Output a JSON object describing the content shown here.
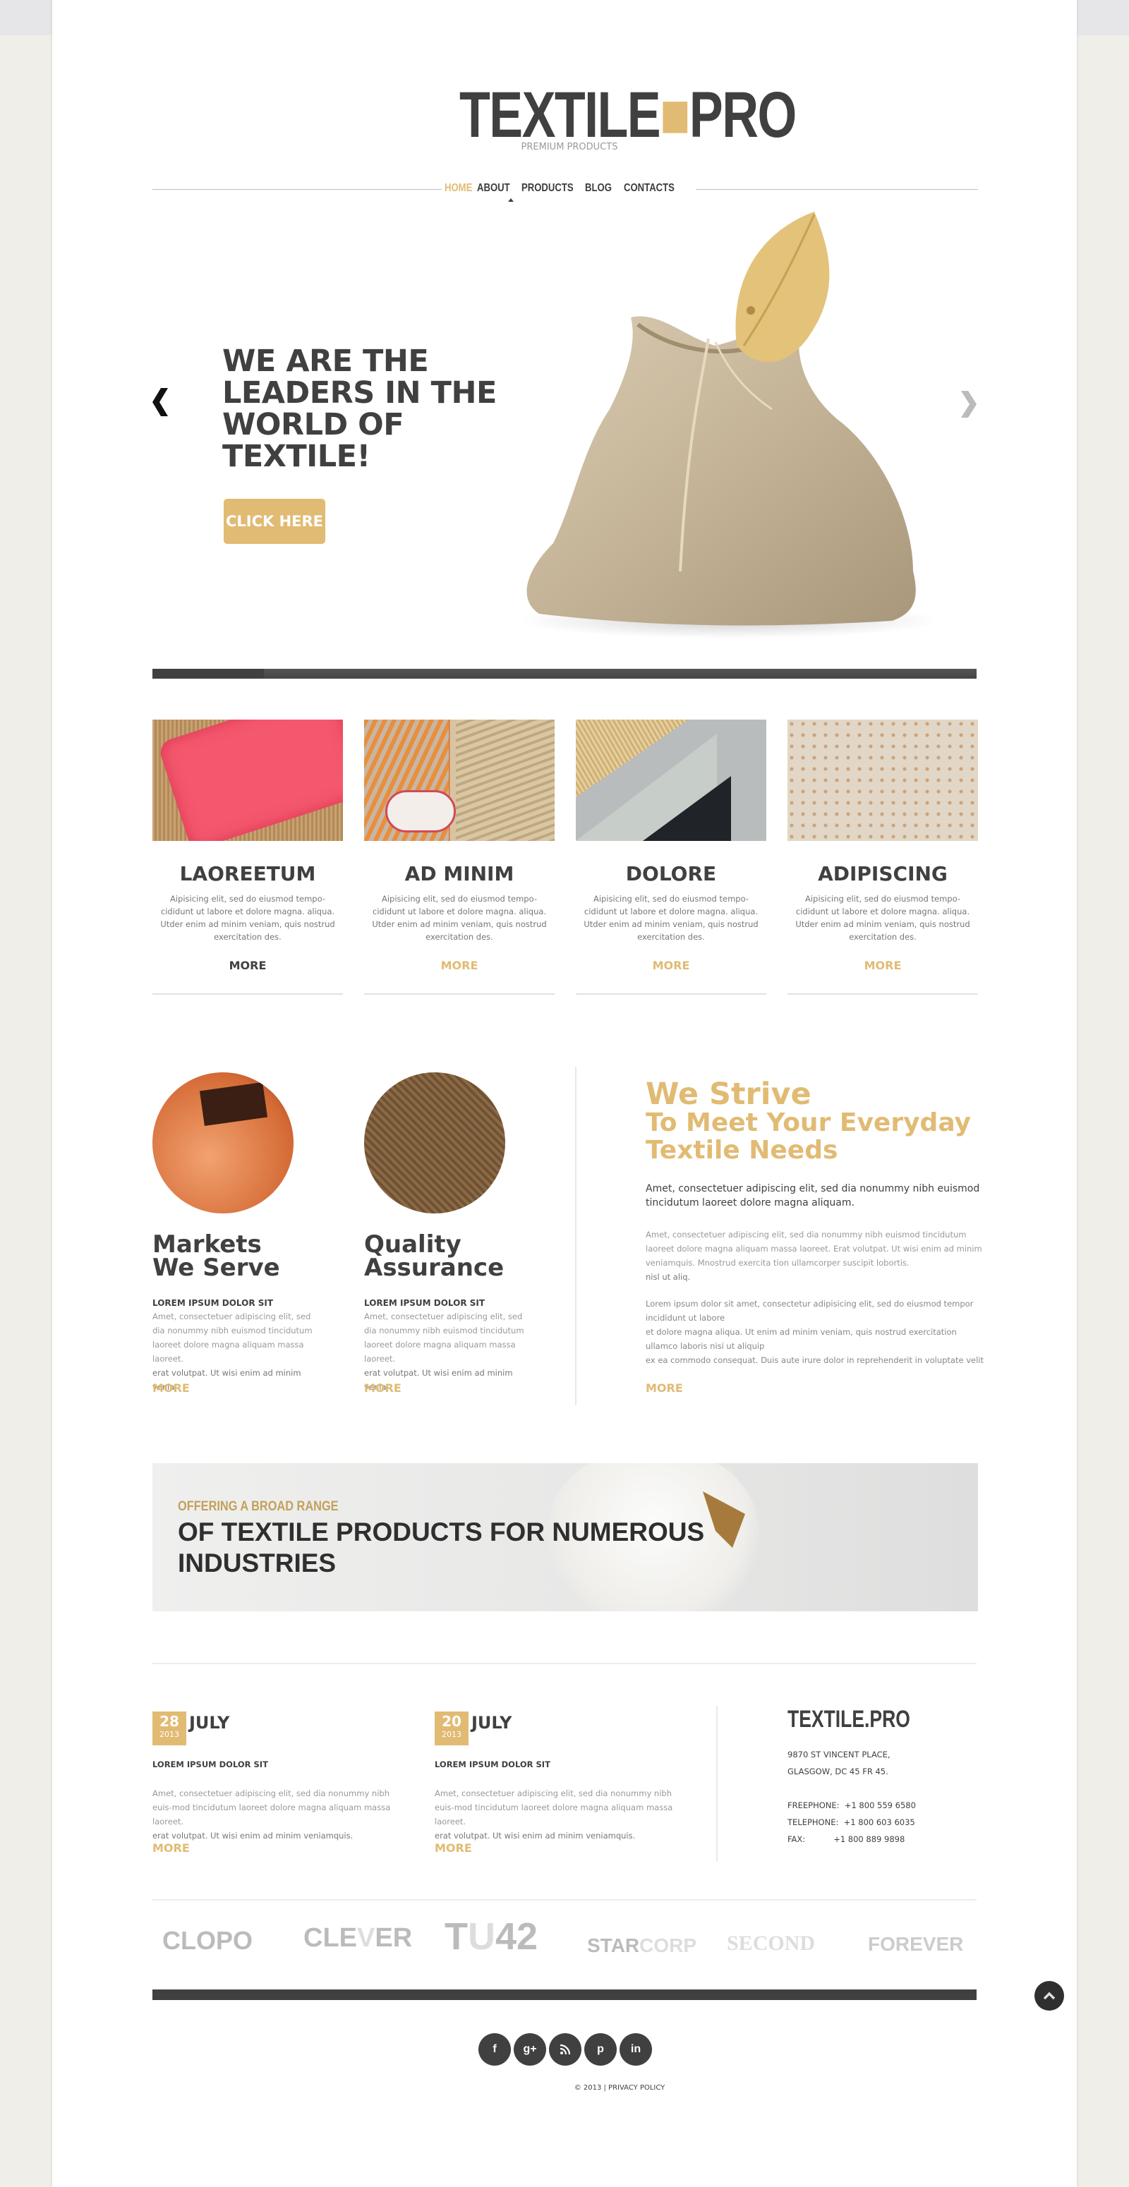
{
  "brand": {
    "name_main": "TEXTILE",
    "name_dot": ".",
    "name_tail": "PRO",
    "tagline": "PREMIUM PRODUCTS"
  },
  "nav": {
    "items": [
      {
        "label": "HOME",
        "active": true
      },
      {
        "label": "ABOUT",
        "active": false
      },
      {
        "label": "PRODUCTS",
        "active": false
      },
      {
        "label": "BLOG",
        "active": false
      },
      {
        "label": "CONTACTS",
        "active": false
      }
    ]
  },
  "hero": {
    "title": "WE ARE THE LEADERS IN THE WORLD OF TEXTILE!",
    "button_label": "CLICK HERE",
    "prev_icon": "chevron-left-icon",
    "next_icon": "chevron-right-icon"
  },
  "products": [
    {
      "title": "LAOREETUM",
      "text": "Aipisicing elit, sed do eiusmod tempo-cididunt ut labore et dolore magna. aliqua. Utder enim ad minim veniam, quis nostrud exercitation des.",
      "more": "MORE"
    },
    {
      "title": "AD MINIM",
      "text": "Aipisicing elit, sed do eiusmod tempo-cididunt ut labore et dolore magna. aliqua. Utder enim ad minim veniam, quis nostrud exercitation des.",
      "more": "MORE"
    },
    {
      "title": "DOLORE",
      "text": "Aipisicing elit, sed do eiusmod tempo-cididunt ut labore et dolore magna. aliqua. Utder enim ad minim veniam, quis nostrud exercitation des.",
      "more": "MORE"
    },
    {
      "title": "ADIPISCING",
      "text": "Aipisicing elit, sed do eiusmod tempo-cididunt ut labore et dolore magna. aliqua. Utder enim ad minim veniam, quis nostrud exercitation des.",
      "more": "MORE"
    }
  ],
  "features": [
    {
      "title_l1": "Markets",
      "title_l2": "We Serve",
      "subtitle": "LOREM IPSUM DOLOR SIT",
      "text": "Amet, consectetuer adipiscing elit, sed dia nonummy nibh euismod tincidutum laoreet dolore magna aliquam massa laoreet.",
      "text2": "erat volutpat. Ut wisi enim ad minim venia-",
      "more": "MORE"
    },
    {
      "title_l1": "Quality",
      "title_l2": "Assurance",
      "subtitle": "LOREM IPSUM DOLOR SIT",
      "text": "Amet, consectetuer adipiscing elit, sed dia nonummy nibh euismod tincidutum laoreet dolore magna aliquam massa laoreet.",
      "text2": "erat volutpat. Ut wisi enim ad minim venia-",
      "more": "MORE"
    }
  ],
  "strive": {
    "title_l1": "We Strive",
    "title_l2": "To Meet Your Everyday",
    "title_l3": "Textile Needs",
    "lead": "Amet, consectetuer adipiscing elit, sed dia nonummy nibh euismod tincidutum laoreet dolore magna aliquam.",
    "para1": "Amet, consectetuer adipiscing elit, sed dia nonummy nibh euismod tincidutum laoreet dolore magna aliquam massa laoreet. Erat volutpat. Ut wisi enim ad minim veniamquis. Mnostrud exercita tion ullamcorper suscipit lobortis.",
    "para1_tail": "nisl ut aliq.",
    "para2_l1": "Lorem ipsum dolor sit amet, consectetur adipisicing elit, sed do eiusmod tempor incididunt ut labore",
    "para2_l2": "et dolore magna aliqua. Ut enim ad minim veniam, quis nostrud exercitation ullamco laboris nisi ut aliquip",
    "para2_l3": "ex ea commodo consequat. Duis aute irure dolor in reprehenderit in voluptate velit",
    "more": "MORE"
  },
  "banner": {
    "subtitle": "OFFERING A BROAD RANGE",
    "title": "OF TEXTILE PRODUCTS FOR NUMEROUS INDUSTRIES"
  },
  "blog": [
    {
      "day": "28",
      "year": "2013",
      "month": "JULY",
      "title": "LOREM IPSUM DOLOR SIT",
      "text": "Amet, consectetuer adipiscing elit, sed dia nonummy nibh euis-mod tincidutum laoreet dolore magna aliquam massa laoreet.",
      "text2": "erat volutpat. Ut wisi enim ad minim veniamquis.",
      "more": "MORE"
    },
    {
      "day": "20",
      "year": "2013",
      "month": "JULY",
      "title": "LOREM IPSUM DOLOR SIT",
      "text": "Amet, consectetuer adipiscing elit, sed dia nonummy nibh euis-mod tincidutum laoreet dolore magna aliquam massa laoreet.",
      "text2": "erat volutpat. Ut wisi enim ad minim veniamquis.",
      "more": "MORE"
    }
  ],
  "contact": {
    "logo": "TEXTILE.PRO",
    "address_l1": "9870 ST VINCENT PLACE,",
    "address_l2": "GLASGOW, DC 45 FR 45.",
    "freephone_label": "FREEPHONE:",
    "freephone": "+1 800 559 6580",
    "telephone_label": "TELEPHONE:",
    "telephone": "+1 800 603 6035",
    "fax_label": "FAX:",
    "fax": "+1 800 889 9898"
  },
  "brands": [
    {
      "a": "CLOPO",
      "b": ""
    },
    {
      "a": "CLE",
      "b": "V",
      "c": "ER"
    },
    {
      "a": "T",
      "b": "U",
      "c": "42"
    },
    {
      "a": "STAR",
      "b": "CORP"
    },
    {
      "a": "SECOND",
      "b": ""
    },
    {
      "a": "FOREVER",
      "b": ""
    }
  ],
  "footer": {
    "social": [
      {
        "name": "facebook",
        "glyph": "f"
      },
      {
        "name": "google-plus",
        "glyph": "g+"
      },
      {
        "name": "rss",
        "glyph": "◢"
      },
      {
        "name": "pinterest",
        "glyph": "p"
      },
      {
        "name": "linkedin",
        "glyph": "in"
      }
    ],
    "copyright": "© 2013 | PRIVACY POLICY"
  },
  "colors": {
    "accent": "#e1bb73",
    "text_dark": "#404040",
    "muted": "#999999",
    "page_bg": "#efeee9"
  }
}
